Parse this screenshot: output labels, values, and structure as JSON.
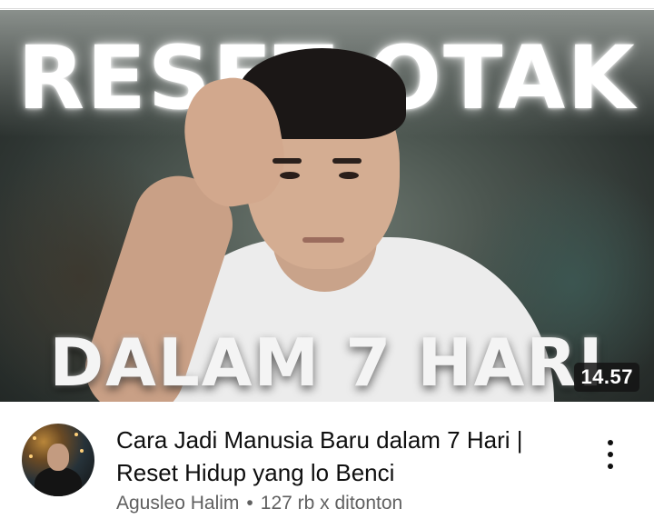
{
  "thumbnail": {
    "headline_top": "RESET OTAK",
    "headline_bottom": "DALAM 7 HARI",
    "duration": "14.57"
  },
  "video": {
    "title": "Cara Jadi Manusia Baru dalam 7 Hari | Reset Hidup yang lo Benci",
    "channel": "Agusleo Halim",
    "separator": "•",
    "views": "127 rb x ditonton"
  },
  "icons": {
    "more": "more-vert-icon",
    "avatar": "channel-avatar"
  }
}
